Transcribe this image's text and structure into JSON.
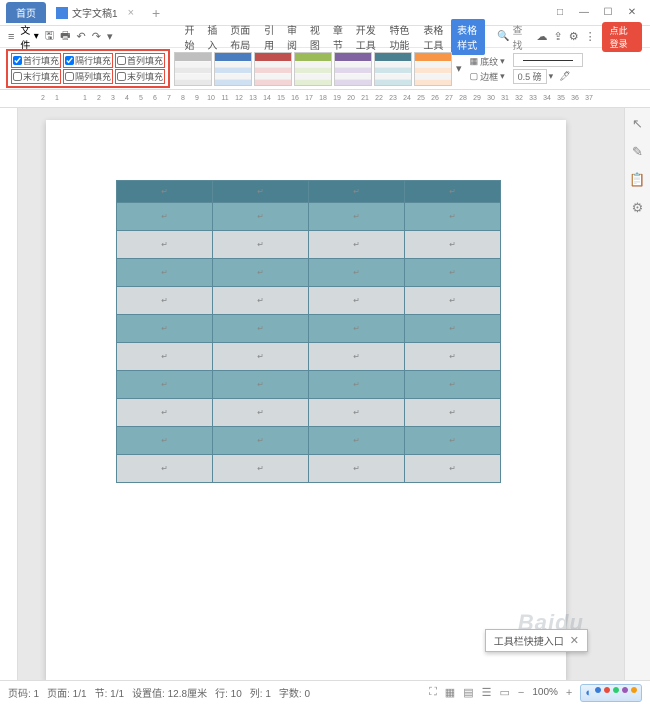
{
  "tabs": {
    "home": "首页",
    "doc": "文字文稿1"
  },
  "toolbar": {
    "file": "文件"
  },
  "menu": [
    "开始",
    "插入",
    "页面布局",
    "引用",
    "审阅",
    "视图",
    "章节",
    "开发工具",
    "特色功能",
    "表格工具",
    "表格样式"
  ],
  "menu_active_index": 10,
  "search": {
    "label": "查找"
  },
  "login": {
    "label": "点此登录"
  },
  "checkboxes": {
    "r1": [
      {
        "label": "首行填充",
        "checked": true
      },
      {
        "label": "隔行填充",
        "checked": true
      },
      {
        "label": "首列填充",
        "checked": false
      }
    ],
    "r2": [
      {
        "label": "末行填充",
        "checked": false
      },
      {
        "label": "隔列填充",
        "checked": false
      },
      {
        "label": "末列填充",
        "checked": false
      }
    ]
  },
  "styles": [
    {
      "header": "#bfbfbf",
      "body": "#e8e8e8"
    },
    {
      "header": "#4a7dbf",
      "body": "#cfe0f2"
    },
    {
      "header": "#c0504d",
      "body": "#f2d5d4"
    },
    {
      "header": "#9bbb59",
      "body": "#e4eed4"
    },
    {
      "header": "#8064a2",
      "body": "#e0d8ea"
    },
    {
      "header": "#4a8090",
      "body": "#cfe4e8"
    },
    {
      "header": "#f79646",
      "body": "#fde4d0"
    }
  ],
  "ribbon_right": {
    "fill": "底纹",
    "border": "边框",
    "width": "0.5 磅"
  },
  "ruler_marks": [
    "2",
    "1",
    "",
    "1",
    "2",
    "3",
    "4",
    "5",
    "6",
    "7",
    "8",
    "9",
    "10",
    "11",
    "12",
    "13",
    "14",
    "15",
    "16",
    "17",
    "18",
    "19",
    "20",
    "21",
    "22",
    "23",
    "24",
    "25",
    "26",
    "27",
    "28",
    "29",
    "30",
    "31",
    "32",
    "33",
    "34",
    "35",
    "36",
    "37"
  ],
  "table": {
    "rows": 11,
    "cols": 4,
    "cell": "↵"
  },
  "status": {
    "page": "页码: 1",
    "pages": "页面: 1/1",
    "section": "节: 1/1",
    "pos": "设置值: 12.8厘米",
    "line": "行: 10",
    "col": "列: 1",
    "chars": "字数: 0",
    "zoom": "100%"
  },
  "tooltip": "工具栏快捷入口",
  "watermark": "Baidu"
}
